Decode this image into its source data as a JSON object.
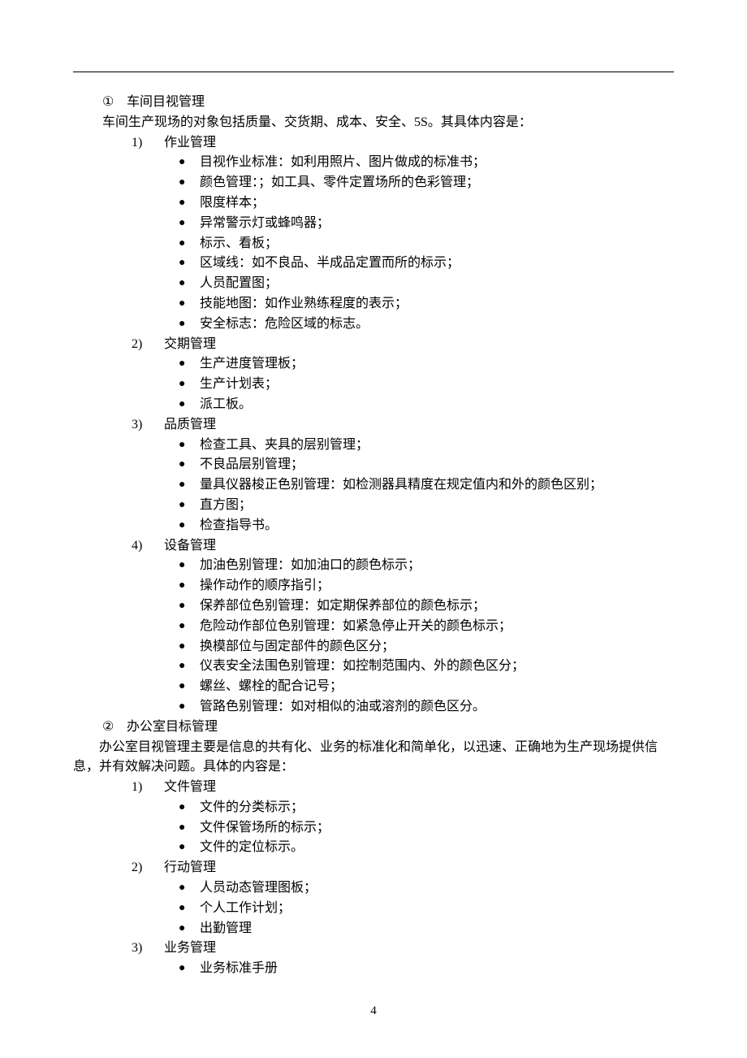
{
  "section1": {
    "num": "①",
    "title": "车间目视管理",
    "intro": "车间生产现场的对象包括质量、交货期、成本、安全、5S。其具体内容是：",
    "lists": [
      {
        "num": "1)",
        "title": "作业管理",
        "items": [
          "目视作业标准：如利用照片、图片做成的标准书；",
          "颜色管理：；如工具、零件定置场所的色彩管理；",
          "限度样本；",
          "异常警示灯或蜂鸣器；",
          "标示、看板；",
          "区域线：如不良品、半成品定置而所的标示；",
          "人员配置图；",
          "技能地图：如作业熟练程度的表示；",
          "安全标志：危险区域的标志。"
        ]
      },
      {
        "num": "2)",
        "title": "交期管理",
        "items": [
          "生产进度管理板；",
          "生产计划表；",
          "派工板。"
        ]
      },
      {
        "num": "3)",
        "title": "品质管理",
        "items": [
          "检查工具、夹具的层别管理；",
          "不良品层别管理；",
          "量具仪器梭正色别管理：如检测器具精度在规定值内和外的颜色区别；",
          "直方图；",
          "检查指导书。"
        ]
      },
      {
        "num": "4)",
        "title": "设备管理",
        "items": [
          "加油色别管理：如加油口的颜色标示；",
          "操作动作的顺序指引；",
          "保养部位色别管理：如定期保养部位的颜色标示；",
          "危险动作部位色别管理：如紧急停止开关的颜色标示；",
          "换模部位与固定部件的颜色区分；",
          "仪表安全法围色别管理：如控制范围内、外的颜色区分；",
          "螺丝、螺栓的配合记号；",
          "管路色别管理：如对相似的油或溶剂的颜色区分。"
        ]
      }
    ]
  },
  "section2": {
    "num": "②",
    "title": "办公室目标管理",
    "intro": "办公室目视管理主要是信息的共有化、业务的标准化和简单化，以迅速、正确地为生产现场提供信息，并有效解决问题。具体的内容是：",
    "lists": [
      {
        "num": "1)",
        "title": "文件管理",
        "items": [
          "文件的分类标示；",
          "文件保管场所的标示；",
          "文件的定位标示。"
        ]
      },
      {
        "num": "2)",
        "title": "行动管理",
        "items": [
          "人员动态管理图板；",
          "个人工作计划；",
          "出勤管理"
        ]
      },
      {
        "num": "3)",
        "title": "业务管理",
        "items": [
          "业务标准手册"
        ]
      }
    ]
  },
  "pageNumber": "4",
  "bulletGlyph": "●"
}
